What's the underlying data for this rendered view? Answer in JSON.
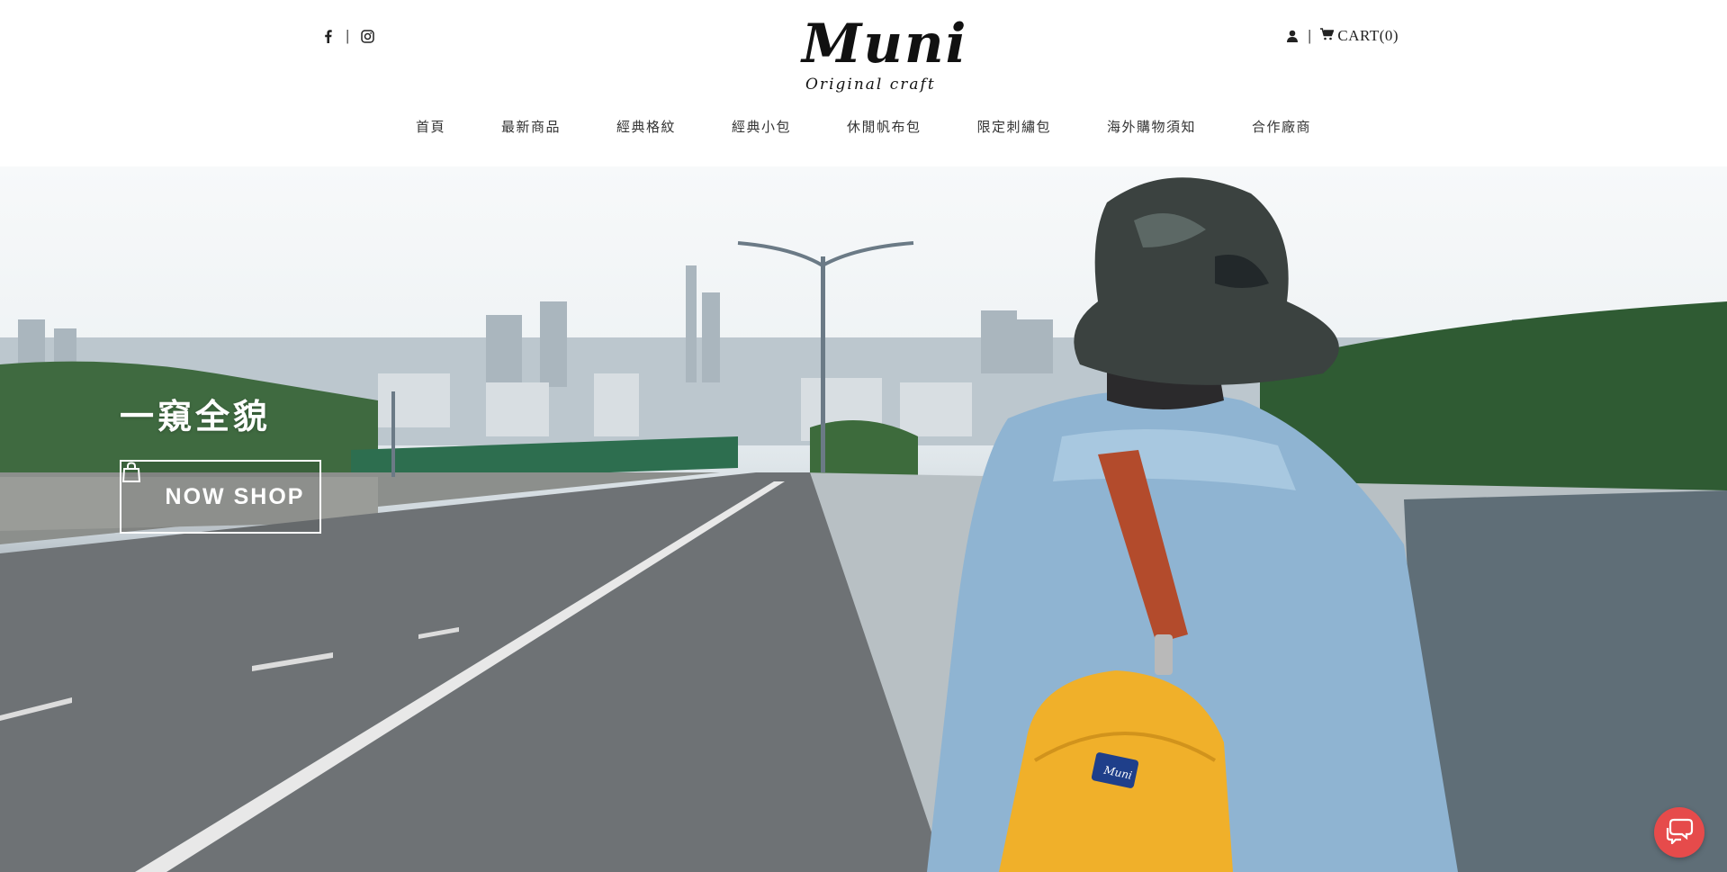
{
  "header": {
    "social": {
      "facebook_icon": "facebook-icon",
      "separator": "|",
      "instagram_icon": "instagram-icon"
    },
    "logo": {
      "word": "Muni",
      "tagline": "Original craft"
    },
    "account": {
      "user_icon": "user-icon",
      "separator": "|",
      "cart_icon": "cart-icon",
      "cart_label": "CART(0)"
    },
    "nav": [
      {
        "label": "首頁"
      },
      {
        "label": "最新商品"
      },
      {
        "label": "經典格紋"
      },
      {
        "label": "經典小包"
      },
      {
        "label": "休閒帆布包"
      },
      {
        "label": "限定刺繡包"
      },
      {
        "label": "海外購物須知"
      },
      {
        "label": "合作廠商"
      }
    ]
  },
  "hero": {
    "title": "一窺全貌",
    "button_label": "NOW SHOP",
    "button_icon": "shopping-bag-icon",
    "backpack_badge": "Muni"
  },
  "chat_widget": {
    "icon": "chat-bubble-icon",
    "color": "#e64b4b"
  },
  "colors": {
    "text": "#333333",
    "background": "#ffffff",
    "hero_button_border": "#ffffff"
  }
}
